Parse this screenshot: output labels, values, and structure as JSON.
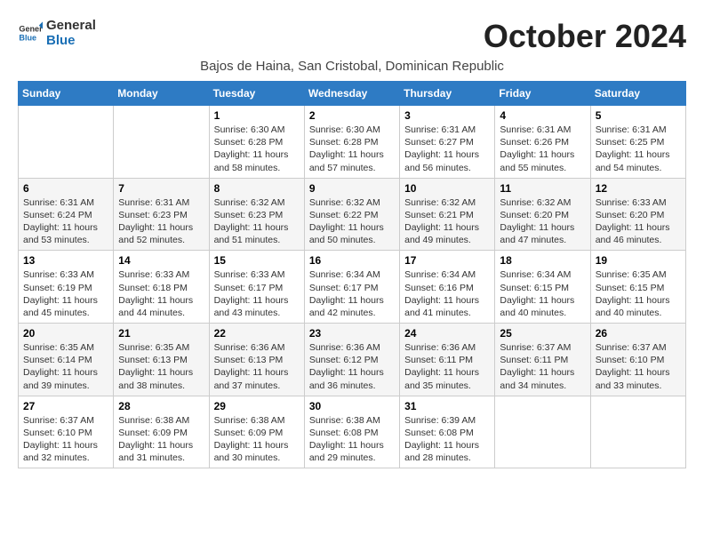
{
  "logo": {
    "line1": "General",
    "line2": "Blue"
  },
  "title": "October 2024",
  "subtitle": "Bajos de Haina, San Cristobal, Dominican Republic",
  "days_of_week": [
    "Sunday",
    "Monday",
    "Tuesday",
    "Wednesday",
    "Thursday",
    "Friday",
    "Saturday"
  ],
  "weeks": [
    [
      {
        "day": "",
        "sunrise": "",
        "sunset": "",
        "daylight": ""
      },
      {
        "day": "",
        "sunrise": "",
        "sunset": "",
        "daylight": ""
      },
      {
        "day": "1",
        "sunrise": "Sunrise: 6:30 AM",
        "sunset": "Sunset: 6:28 PM",
        "daylight": "Daylight: 11 hours and 58 minutes."
      },
      {
        "day": "2",
        "sunrise": "Sunrise: 6:30 AM",
        "sunset": "Sunset: 6:28 PM",
        "daylight": "Daylight: 11 hours and 57 minutes."
      },
      {
        "day": "3",
        "sunrise": "Sunrise: 6:31 AM",
        "sunset": "Sunset: 6:27 PM",
        "daylight": "Daylight: 11 hours and 56 minutes."
      },
      {
        "day": "4",
        "sunrise": "Sunrise: 6:31 AM",
        "sunset": "Sunset: 6:26 PM",
        "daylight": "Daylight: 11 hours and 55 minutes."
      },
      {
        "day": "5",
        "sunrise": "Sunrise: 6:31 AM",
        "sunset": "Sunset: 6:25 PM",
        "daylight": "Daylight: 11 hours and 54 minutes."
      }
    ],
    [
      {
        "day": "6",
        "sunrise": "Sunrise: 6:31 AM",
        "sunset": "Sunset: 6:24 PM",
        "daylight": "Daylight: 11 hours and 53 minutes."
      },
      {
        "day": "7",
        "sunrise": "Sunrise: 6:31 AM",
        "sunset": "Sunset: 6:23 PM",
        "daylight": "Daylight: 11 hours and 52 minutes."
      },
      {
        "day": "8",
        "sunrise": "Sunrise: 6:32 AM",
        "sunset": "Sunset: 6:23 PM",
        "daylight": "Daylight: 11 hours and 51 minutes."
      },
      {
        "day": "9",
        "sunrise": "Sunrise: 6:32 AM",
        "sunset": "Sunset: 6:22 PM",
        "daylight": "Daylight: 11 hours and 50 minutes."
      },
      {
        "day": "10",
        "sunrise": "Sunrise: 6:32 AM",
        "sunset": "Sunset: 6:21 PM",
        "daylight": "Daylight: 11 hours and 49 minutes."
      },
      {
        "day": "11",
        "sunrise": "Sunrise: 6:32 AM",
        "sunset": "Sunset: 6:20 PM",
        "daylight": "Daylight: 11 hours and 47 minutes."
      },
      {
        "day": "12",
        "sunrise": "Sunrise: 6:33 AM",
        "sunset": "Sunset: 6:20 PM",
        "daylight": "Daylight: 11 hours and 46 minutes."
      }
    ],
    [
      {
        "day": "13",
        "sunrise": "Sunrise: 6:33 AM",
        "sunset": "Sunset: 6:19 PM",
        "daylight": "Daylight: 11 hours and 45 minutes."
      },
      {
        "day": "14",
        "sunrise": "Sunrise: 6:33 AM",
        "sunset": "Sunset: 6:18 PM",
        "daylight": "Daylight: 11 hours and 44 minutes."
      },
      {
        "day": "15",
        "sunrise": "Sunrise: 6:33 AM",
        "sunset": "Sunset: 6:17 PM",
        "daylight": "Daylight: 11 hours and 43 minutes."
      },
      {
        "day": "16",
        "sunrise": "Sunrise: 6:34 AM",
        "sunset": "Sunset: 6:17 PM",
        "daylight": "Daylight: 11 hours and 42 minutes."
      },
      {
        "day": "17",
        "sunrise": "Sunrise: 6:34 AM",
        "sunset": "Sunset: 6:16 PM",
        "daylight": "Daylight: 11 hours and 41 minutes."
      },
      {
        "day": "18",
        "sunrise": "Sunrise: 6:34 AM",
        "sunset": "Sunset: 6:15 PM",
        "daylight": "Daylight: 11 hours and 40 minutes."
      },
      {
        "day": "19",
        "sunrise": "Sunrise: 6:35 AM",
        "sunset": "Sunset: 6:15 PM",
        "daylight": "Daylight: 11 hours and 40 minutes."
      }
    ],
    [
      {
        "day": "20",
        "sunrise": "Sunrise: 6:35 AM",
        "sunset": "Sunset: 6:14 PM",
        "daylight": "Daylight: 11 hours and 39 minutes."
      },
      {
        "day": "21",
        "sunrise": "Sunrise: 6:35 AM",
        "sunset": "Sunset: 6:13 PM",
        "daylight": "Daylight: 11 hours and 38 minutes."
      },
      {
        "day": "22",
        "sunrise": "Sunrise: 6:36 AM",
        "sunset": "Sunset: 6:13 PM",
        "daylight": "Daylight: 11 hours and 37 minutes."
      },
      {
        "day": "23",
        "sunrise": "Sunrise: 6:36 AM",
        "sunset": "Sunset: 6:12 PM",
        "daylight": "Daylight: 11 hours and 36 minutes."
      },
      {
        "day": "24",
        "sunrise": "Sunrise: 6:36 AM",
        "sunset": "Sunset: 6:11 PM",
        "daylight": "Daylight: 11 hours and 35 minutes."
      },
      {
        "day": "25",
        "sunrise": "Sunrise: 6:37 AM",
        "sunset": "Sunset: 6:11 PM",
        "daylight": "Daylight: 11 hours and 34 minutes."
      },
      {
        "day": "26",
        "sunrise": "Sunrise: 6:37 AM",
        "sunset": "Sunset: 6:10 PM",
        "daylight": "Daylight: 11 hours and 33 minutes."
      }
    ],
    [
      {
        "day": "27",
        "sunrise": "Sunrise: 6:37 AM",
        "sunset": "Sunset: 6:10 PM",
        "daylight": "Daylight: 11 hours and 32 minutes."
      },
      {
        "day": "28",
        "sunrise": "Sunrise: 6:38 AM",
        "sunset": "Sunset: 6:09 PM",
        "daylight": "Daylight: 11 hours and 31 minutes."
      },
      {
        "day": "29",
        "sunrise": "Sunrise: 6:38 AM",
        "sunset": "Sunset: 6:09 PM",
        "daylight": "Daylight: 11 hours and 30 minutes."
      },
      {
        "day": "30",
        "sunrise": "Sunrise: 6:38 AM",
        "sunset": "Sunset: 6:08 PM",
        "daylight": "Daylight: 11 hours and 29 minutes."
      },
      {
        "day": "31",
        "sunrise": "Sunrise: 6:39 AM",
        "sunset": "Sunset: 6:08 PM",
        "daylight": "Daylight: 11 hours and 28 minutes."
      },
      {
        "day": "",
        "sunrise": "",
        "sunset": "",
        "daylight": ""
      },
      {
        "day": "",
        "sunrise": "",
        "sunset": "",
        "daylight": ""
      }
    ]
  ]
}
